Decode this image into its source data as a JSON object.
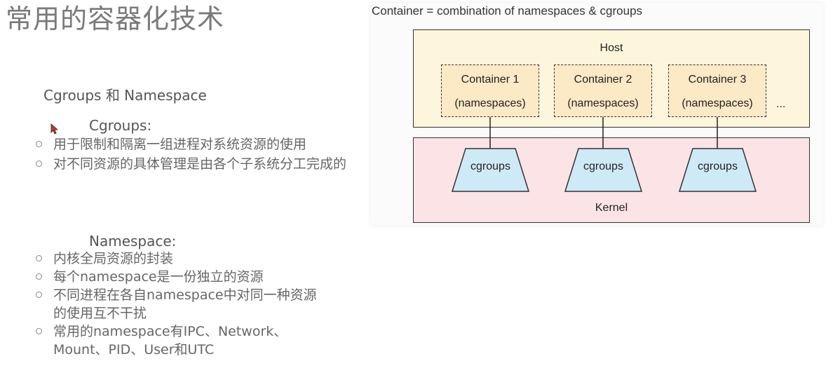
{
  "slide": {
    "title": "常用的容器化技术",
    "subtitle": "Cgroups 和 Namespace"
  },
  "cgroups": {
    "heading": "Cgroups:",
    "bullets": [
      "用于限制和隔离一组进程对系统资源的使用",
      "对不同资源的具体管理是由各个子系统分工完成的"
    ]
  },
  "namespace": {
    "heading": "Namespace:",
    "bullets": [
      "内核全局资源的封装",
      "每个namespace是一份独立的资源",
      "不同进程在各自namespace中对同一种资源的使用互不干扰",
      "常用的namespace有IPC、Network、Mount、PID、User和UTC"
    ]
  },
  "diagram": {
    "caption": "Container = combination of namespaces & cgroups",
    "host_label": "Host",
    "kernel_label": "Kernel",
    "containers": [
      {
        "name": "Container 1",
        "detail": "(namespaces)"
      },
      {
        "name": "Container 2",
        "detail": "(namespaces)"
      },
      {
        "name": "Container 3",
        "detail": "(namespaces)"
      }
    ],
    "ellipsis": "...",
    "cgroups_label": "cgroups",
    "colors": {
      "host_fill": "#fdf6dc",
      "kernel_fill": "#fbe3e6",
      "container_fill": "#fce9c6",
      "cgroups_fill": "#cfeaf7"
    }
  }
}
